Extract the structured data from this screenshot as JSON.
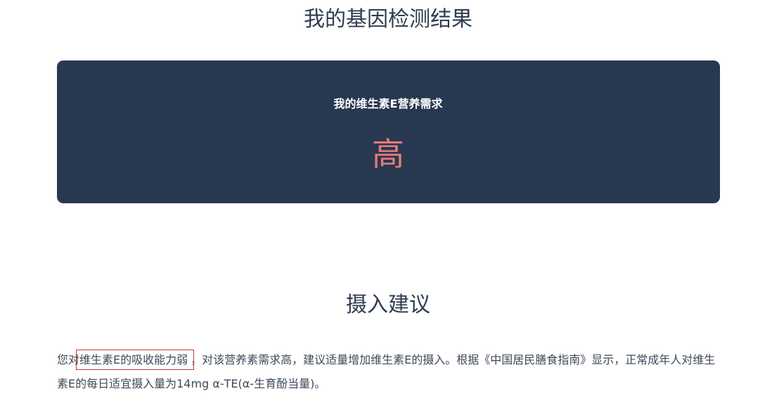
{
  "header": {
    "title": "我的基因检测结果"
  },
  "result_card": {
    "label": "我的维生素E营养需求",
    "value": "高",
    "value_color": "#ea7a79",
    "background": "#283850"
  },
  "advice_section": {
    "title": "摄入建议",
    "text_prefix": "您对",
    "text_highlight": "维生素E的吸收能力弱",
    "text_suffix": "，对该营养素需求高，建议适量增加维生素E的摄入。根据《中国居民膳食指南》显示，正常成年人对维生素E的每日适宜摄入量为14mg α-TE(α-生育酚当量)。",
    "highlight_border_color": "#c9363a"
  }
}
